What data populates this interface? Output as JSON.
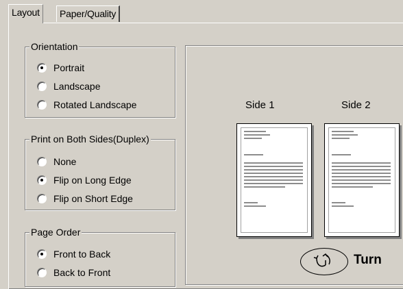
{
  "tabs": [
    {
      "label": "Layout",
      "active": true
    },
    {
      "label": "Paper/Quality",
      "active": false
    }
  ],
  "orientation": {
    "title": "Orientation",
    "options": [
      {
        "label": "Portrait",
        "checked": true
      },
      {
        "label": "Landscape",
        "checked": false
      },
      {
        "label": "Rotated Landscape",
        "checked": false
      }
    ]
  },
  "duplex": {
    "title": "Print on Both Sides(Duplex)",
    "options": [
      {
        "label": "None",
        "checked": false
      },
      {
        "label": "Flip on Long Edge",
        "checked": true
      },
      {
        "label": "Flip on Short Edge",
        "checked": false
      }
    ]
  },
  "page_order": {
    "title": "Page Order",
    "options": [
      {
        "label": "Front to Back",
        "checked": true
      },
      {
        "label": "Back to Front",
        "checked": false
      }
    ]
  },
  "preview": {
    "side1_label": "Side 1",
    "side2_label": "Side 2",
    "turn_label": "Turn",
    "turn_icon": "flip-page-icon"
  }
}
